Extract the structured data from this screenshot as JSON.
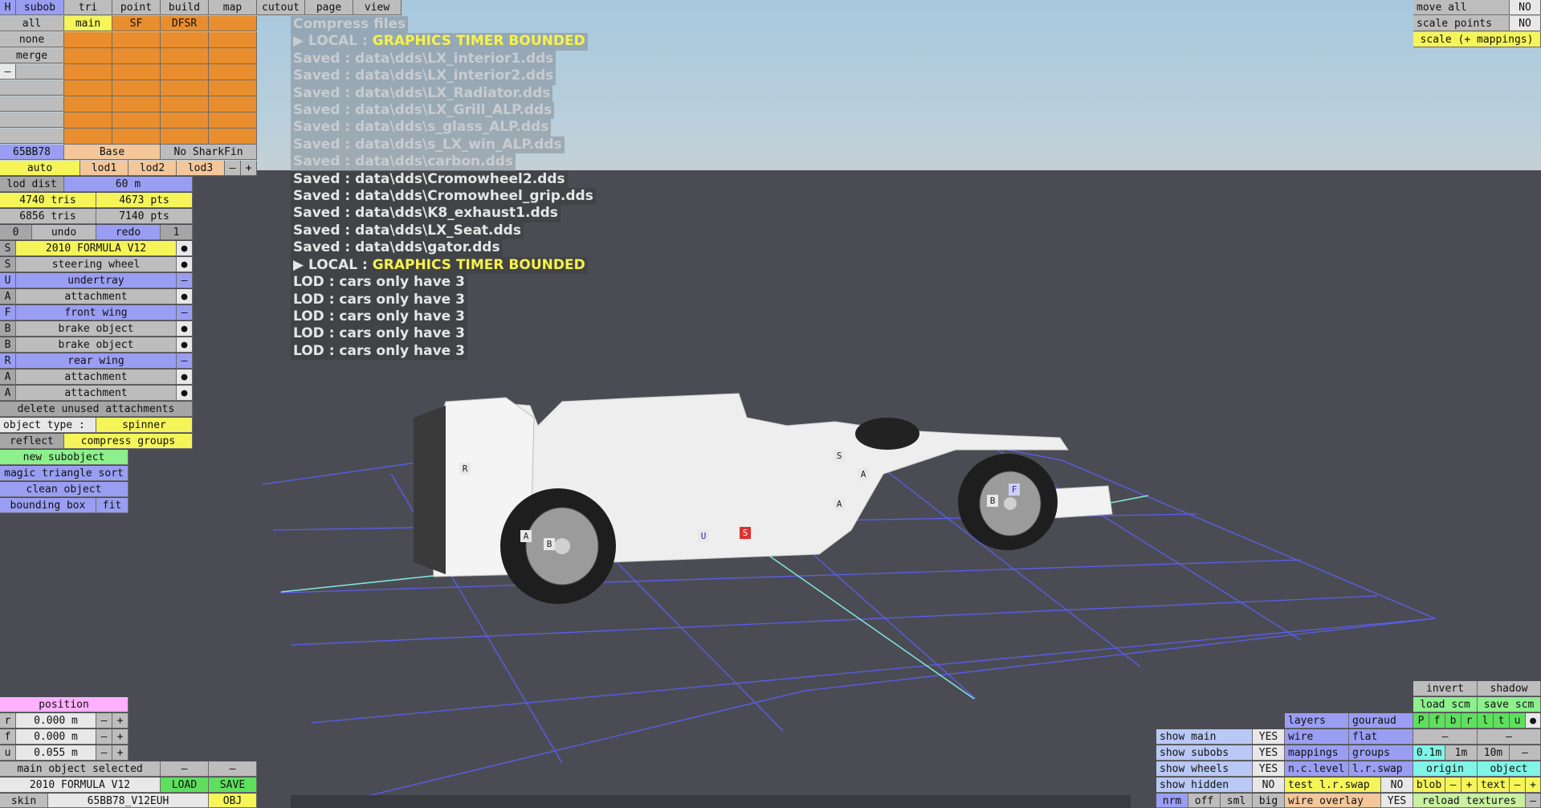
{
  "top_tabs": [
    "subob",
    "tri",
    "point",
    "build",
    "map",
    "cutout",
    "page",
    "view"
  ],
  "h_label": "H",
  "col_headers": {
    "all": "all",
    "main": "main",
    "sf": "SF",
    "dfsr": "DFSR"
  },
  "none": "none",
  "merge": "merge",
  "minus": "–",
  "plus": "+",
  "dot": "●",
  "color_hex": "65BB78",
  "base": "Base",
  "no_sharkfin": "No SharkFin",
  "lods": [
    "auto",
    "lod1",
    "lod2",
    "lod3"
  ],
  "lod_dist_label": "lod dist",
  "lod_dist_value": "60 m",
  "tris1": "4740 tris",
  "pts1": "4673 pts",
  "tris2": "6856 tris",
  "pts2": "7140 pts",
  "undo_count": "0",
  "undo": "undo",
  "redo": "redo",
  "redo_count": "1",
  "subobjects": [
    {
      "letter": "S",
      "name": "2010 FORMULA V12",
      "mark": "●"
    },
    {
      "letter": "S",
      "name": "steering wheel",
      "mark": "●"
    },
    {
      "letter": "U",
      "name": "undertray",
      "mark": "–"
    },
    {
      "letter": "A",
      "name": "attachment",
      "mark": "●"
    },
    {
      "letter": "F",
      "name": "front wing",
      "mark": "–"
    },
    {
      "letter": "B",
      "name": "brake object",
      "mark": "●"
    },
    {
      "letter": "B",
      "name": "brake object",
      "mark": "●"
    },
    {
      "letter": "R",
      "name": "rear wing",
      "mark": "–"
    },
    {
      "letter": "A",
      "name": "attachment",
      "mark": "●"
    },
    {
      "letter": "A",
      "name": "attachment",
      "mark": "●"
    }
  ],
  "delete_unused": "delete unused attachments",
  "object_type_label": "object type :",
  "object_type_value": "spinner",
  "reflect": "reflect",
  "compress_groups": "compress groups",
  "new_subobject": "new subobject",
  "magic_sort": "magic triangle sort",
  "clean_object": "clean object",
  "bounding_box": "bounding box",
  "fit": "fit",
  "log": [
    {
      "text": "Compress files",
      "faded": true
    },
    {
      "prefix": "▶ LOCAL : ",
      "hl": "GRAPHICS TIMER BOUNDED",
      "faded": true
    },
    {
      "text": "Saved : data\\dds\\LX_interior1.dds",
      "faded": true
    },
    {
      "text": "Saved : data\\dds\\LX_interior2.dds",
      "faded": true
    },
    {
      "text": "Saved : data\\dds\\LX_Radiator.dds",
      "faded": true
    },
    {
      "text": "Saved : data\\dds\\LX_Grill_ALP.dds",
      "faded": true
    },
    {
      "text": "Saved : data\\dds\\s_glass_ALP.dds",
      "faded": true
    },
    {
      "text": "Saved : data\\dds\\s_LX_win_ALP.dds",
      "faded": true
    },
    {
      "text": "Saved : data\\dds\\carbon.dds",
      "faded": true
    },
    {
      "text": "Saved : data\\dds\\Cromowheel2.dds"
    },
    {
      "text": "Saved : data\\dds\\Cromowheel_grip.dds"
    },
    {
      "text": "Saved : data\\dds\\K8_exhaust1.dds"
    },
    {
      "text": "Saved : data\\dds\\LX_Seat.dds"
    },
    {
      "text": "Saved : data\\dds\\gator.dds"
    },
    {
      "prefix": "▶ LOCAL : ",
      "hl": "GRAPHICS TIMER BOUNDED"
    },
    {
      "text": "LOD : cars only have 3"
    },
    {
      "text": "LOD : cars only have 3"
    },
    {
      "text": "LOD : cars only have 3"
    },
    {
      "text": "LOD : cars only have 3"
    },
    {
      "text": "LOD : cars only have 3"
    }
  ],
  "top_right": {
    "move_all": "move all",
    "move_all_val": "NO",
    "scale_points": "scale points",
    "scale_points_val": "NO",
    "scale_mappings": "scale (+ mappings)"
  },
  "position": {
    "title": "position",
    "rows": [
      {
        "axis": "r",
        "value": "0.000 m"
      },
      {
        "axis": "f",
        "value": "0.000 m"
      },
      {
        "axis": "u",
        "value": "0.055 m"
      }
    ]
  },
  "main_selected": "main object selected",
  "object_name": "2010 FORMULA V12",
  "load": "LOAD",
  "save": "SAVE",
  "skin_label": "skin",
  "skin_value": "65BB78_V12EUH",
  "obj": "OBJ",
  "br": {
    "invert": "invert",
    "shadow": "shadow",
    "load_scm": "load scm",
    "save_scm": "save scm",
    "layers": "layers",
    "gouraud": "gouraud",
    "layer_flags": [
      "P",
      "f",
      "b",
      "r",
      "l",
      "t",
      "u",
      "●"
    ],
    "show_main": "show main",
    "show_main_val": "YES",
    "wire": "wire",
    "flat": "flat",
    "show_subobs": "show subobs",
    "show_subobs_val": "YES",
    "mappings": "mappings",
    "groups": "groups",
    "grid_sizes": [
      "0.1m",
      "1m",
      "10m"
    ],
    "show_wheels": "show wheels",
    "show_wheels_val": "YES",
    "nclevel": "n.c.level",
    "lrswap": "l.r.swap",
    "origin": "origin",
    "object": "object",
    "show_hidden": "show hidden",
    "show_hidden_val": "NO",
    "test_lrswap": "test l.r.swap",
    "test_lrswap_val": "NO",
    "blob": "blob",
    "text": "text",
    "view_modes": [
      "nrm",
      "off",
      "sml",
      "big"
    ],
    "wire_overlay": "wire overlay",
    "wire_overlay_val": "YES",
    "reload_textures": "reload textures"
  },
  "markers": [
    "R",
    "S",
    "A",
    "A",
    "B",
    "A",
    "B",
    "U",
    "S",
    "F"
  ],
  "colors": {
    "orange": "#e88e2e",
    "yellow": "#f5f55a",
    "blue": "#9a9ef2",
    "grid": "#5b5ef0",
    "cyan": "#7fe8e0"
  }
}
